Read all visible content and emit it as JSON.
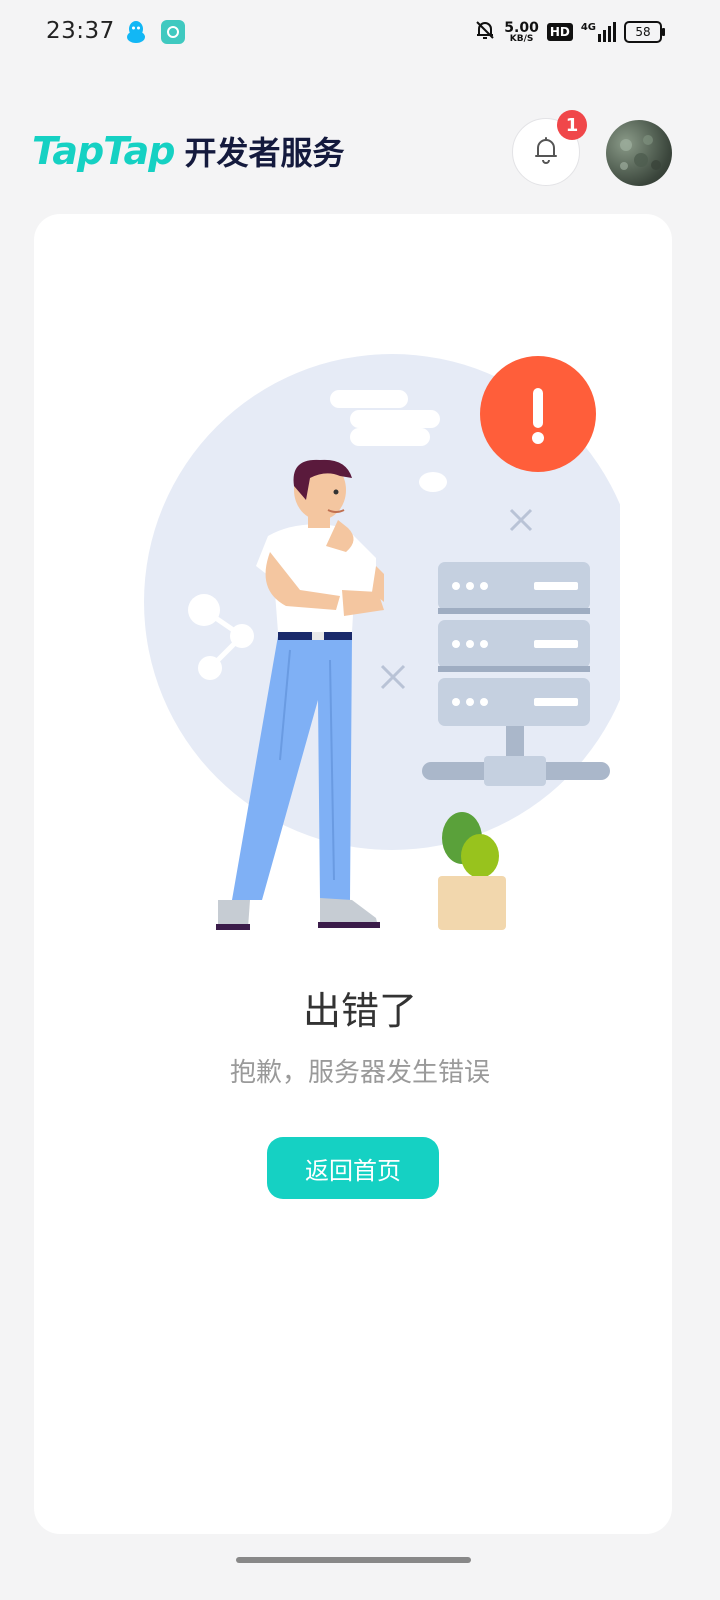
{
  "status_bar": {
    "time": "23:37",
    "net_speed_value": "5.00",
    "net_speed_unit": "KB/S",
    "hd_label": "HD",
    "network_label": "4G",
    "battery": "58"
  },
  "header": {
    "logo_brand": "TapTap",
    "logo_service": "开发者服务",
    "notification_count": "1"
  },
  "error": {
    "title": "出错了",
    "message": "抱歉，服务器发生错误",
    "home_button": "返回首页"
  },
  "colors": {
    "accent": "#15d1c3",
    "badge": "#f0474a",
    "alert": "#ff5e3a"
  }
}
